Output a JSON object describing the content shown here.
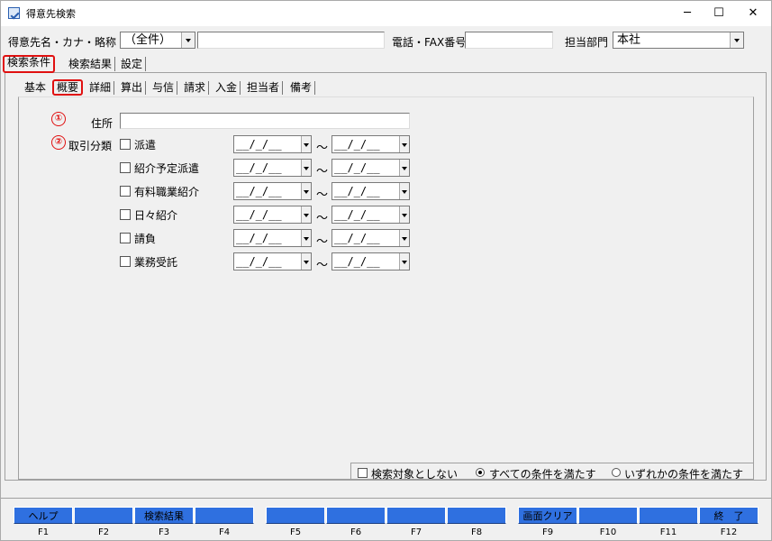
{
  "window": {
    "title": "得意先検索",
    "minimize": "─",
    "maximize": "☐",
    "close": "✕"
  },
  "search": {
    "name_label": "得意先名・カナ・略称",
    "name_mode": "（全件）",
    "name_value": "",
    "phone_label": "電話・FAX番号",
    "phone_value": "",
    "dept_label": "担当部門",
    "dept_value": "本社"
  },
  "top_tabs": [
    "検索条件",
    "検索結果",
    "設定"
  ],
  "sub_tabs": [
    "基本",
    "概要",
    "詳細",
    "算出",
    "与信",
    "請求",
    "入金",
    "担当者",
    "備考"
  ],
  "markers": [
    "①",
    "②"
  ],
  "address": {
    "label": "住所",
    "value": ""
  },
  "category": {
    "label": "取引分類",
    "items": [
      "派遣",
      "紹介予定派遣",
      "有料職業紹介",
      "日々紹介",
      "請負",
      "業務受託"
    ],
    "date_placeholder": "__/_/__",
    "range_sep": "～"
  },
  "options": {
    "exclude_label": "検索対象としない",
    "all_label": "すべての条件を満たす",
    "any_label": "いずれかの条件を満たす",
    "selected": "all"
  },
  "fkeys": [
    {
      "key": "F1",
      "label": "ヘルプ"
    },
    {
      "key": "F2",
      "label": ""
    },
    {
      "key": "F3",
      "label": "検索結果"
    },
    {
      "key": "F4",
      "label": ""
    },
    {
      "key": "F5",
      "label": ""
    },
    {
      "key": "F6",
      "label": ""
    },
    {
      "key": "F7",
      "label": ""
    },
    {
      "key": "F8",
      "label": ""
    },
    {
      "key": "F9",
      "label": "画面クリア"
    },
    {
      "key": "F10",
      "label": ""
    },
    {
      "key": "F11",
      "label": ""
    },
    {
      "key": "F12",
      "label": "終　了"
    }
  ]
}
